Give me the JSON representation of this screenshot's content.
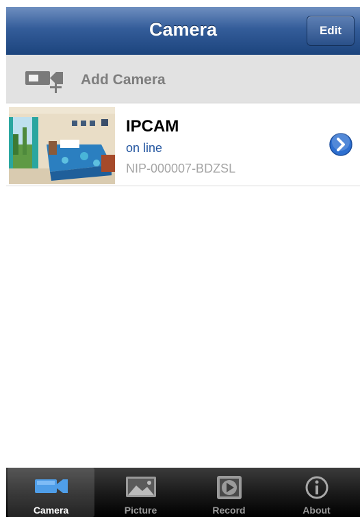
{
  "nav": {
    "title": "Camera",
    "edit_label": "Edit"
  },
  "add_camera": {
    "label": "Add Camera",
    "icon": "video-camera-add-icon"
  },
  "cameras": [
    {
      "name": "IPCAM",
      "status": "on line",
      "id": "NIP-000007-BDZSL"
    }
  ],
  "tabs": [
    {
      "label": "Camera",
      "icon": "video-camera-icon",
      "active": true
    },
    {
      "label": "Picture",
      "icon": "picture-icon",
      "active": false
    },
    {
      "label": "Record",
      "icon": "record-film-icon",
      "active": false
    },
    {
      "label": "About",
      "icon": "info-icon",
      "active": false
    }
  ],
  "colors": {
    "nav_bar": "#345d9a",
    "status_online": "#2456a0",
    "disclosure_blue": "#2d6fd0"
  }
}
